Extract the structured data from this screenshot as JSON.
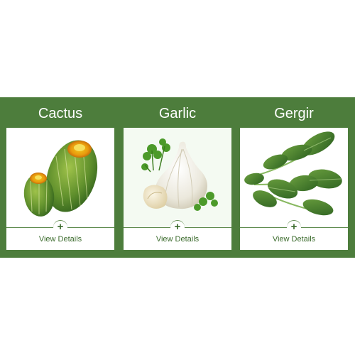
{
  "products": [
    {
      "name": "Cactus",
      "icon": "cactus-icon",
      "link_label": "View Details",
      "plus": "+"
    },
    {
      "name": "Garlic",
      "icon": "garlic-icon",
      "link_label": "View Details",
      "plus": "+"
    },
    {
      "name": "Gergir",
      "icon": "arugula-icon",
      "link_label": "View Details",
      "plus": "+"
    }
  ],
  "colors": {
    "band": "#4d7d3c",
    "accent": "#3b6b2c",
    "card": "#ffffff"
  }
}
